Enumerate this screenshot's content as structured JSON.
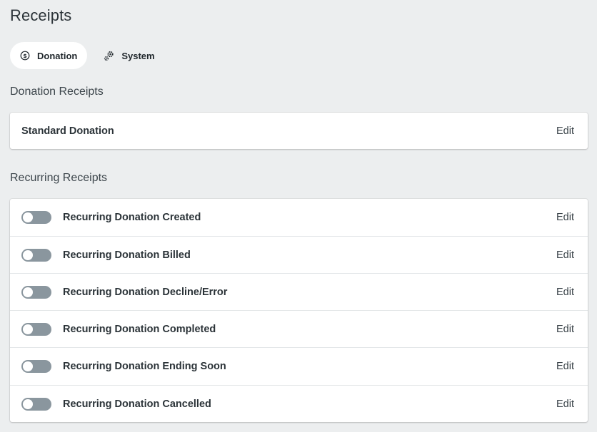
{
  "page": {
    "title": "Receipts"
  },
  "tabs": [
    {
      "label": "Donation",
      "icon": "dollar-circle-icon",
      "active": true
    },
    {
      "label": "System",
      "icon": "gears-icon",
      "active": false
    }
  ],
  "donation_section": {
    "title": "Donation Receipts",
    "rows": [
      {
        "label": "Standard Donation",
        "action": "Edit"
      }
    ]
  },
  "recurring_section": {
    "title": "Recurring Receipts",
    "rows": [
      {
        "label": "Recurring Donation Created",
        "action": "Edit",
        "enabled": false
      },
      {
        "label": "Recurring Donation Billed",
        "action": "Edit",
        "enabled": false
      },
      {
        "label": "Recurring Donation Decline/Error",
        "action": "Edit",
        "enabled": false
      },
      {
        "label": "Recurring Donation Completed",
        "action": "Edit",
        "enabled": false
      },
      {
        "label": "Recurring Donation Ending Soon",
        "action": "Edit",
        "enabled": false
      },
      {
        "label": "Recurring Donation Cancelled",
        "action": "Edit",
        "enabled": false
      }
    ]
  },
  "colors": {
    "background": "#eceeef",
    "card": "#ffffff",
    "toggle_off": "#8a969e",
    "text": "#2b3338"
  }
}
